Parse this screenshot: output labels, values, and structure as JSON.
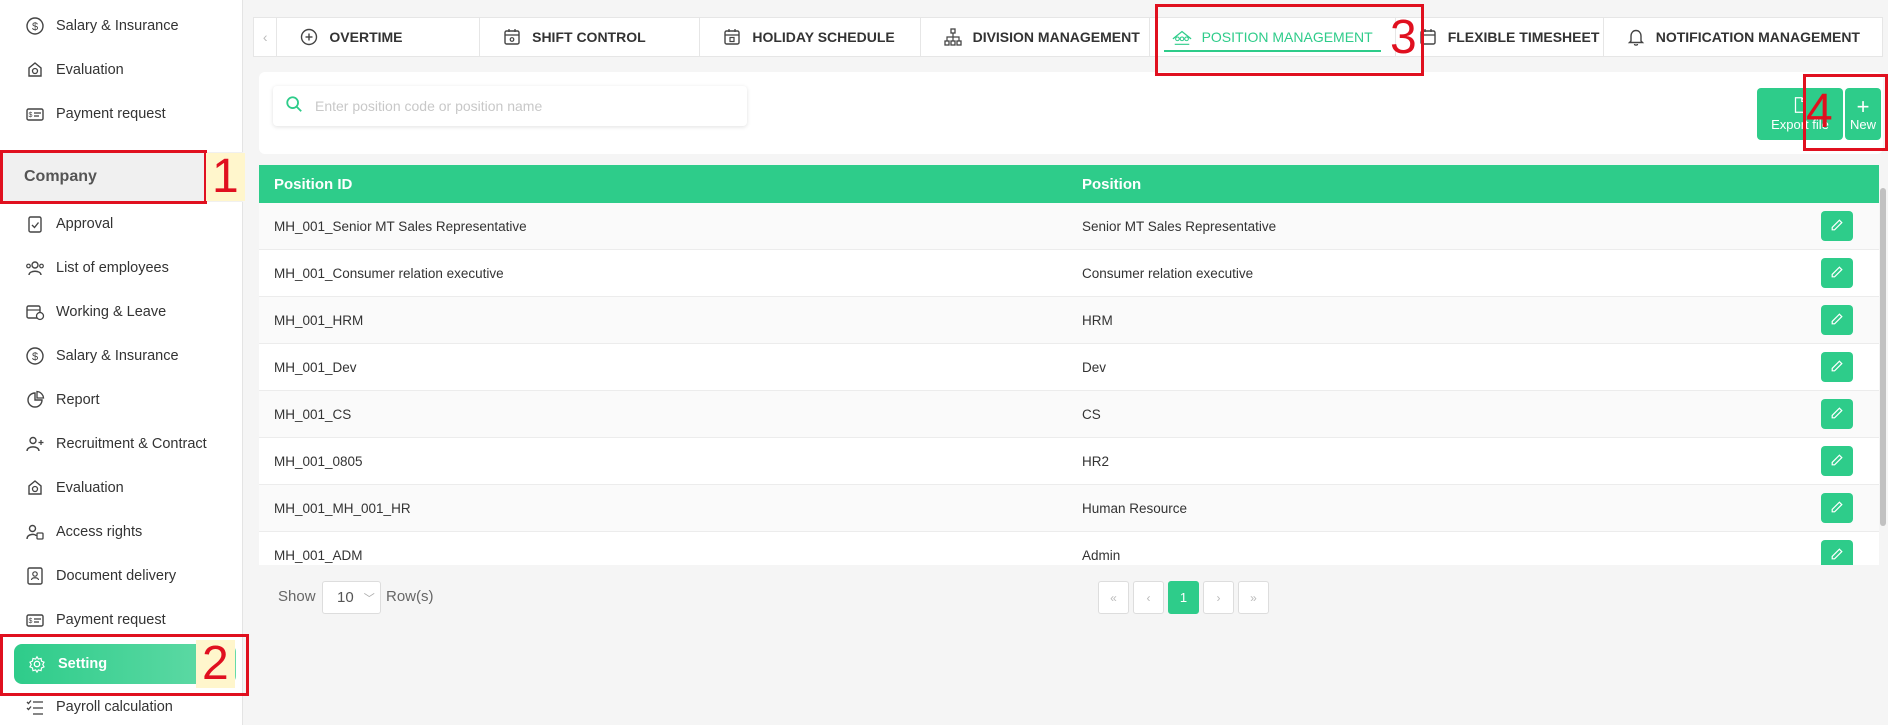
{
  "sidebar": {
    "top_items": [
      {
        "label": "Salary & Insurance",
        "icon": "dollar-icon"
      },
      {
        "label": "Evaluation",
        "icon": "evaluation-icon"
      },
      {
        "label": "Payment request",
        "icon": "payment-icon"
      }
    ],
    "company_header": "Company",
    "company_items": [
      {
        "label": "Approval",
        "icon": "clipboard-check-icon"
      },
      {
        "label": "List of employees",
        "icon": "users-icon"
      },
      {
        "label": "Working & Leave",
        "icon": "calendar-clock-icon"
      },
      {
        "label": "Salary & Insurance",
        "icon": "dollar-icon"
      },
      {
        "label": "Report",
        "icon": "pie-chart-icon"
      },
      {
        "label": "Recruitment & Contract",
        "icon": "user-plus-icon"
      },
      {
        "label": "Evaluation",
        "icon": "evaluation-icon"
      },
      {
        "label": "Access rights",
        "icon": "user-lock-icon"
      },
      {
        "label": "Document delivery",
        "icon": "id-card-icon"
      },
      {
        "label": "Payment request",
        "icon": "payment-icon"
      }
    ],
    "setting_label": "Setting",
    "payroll_label": "Payroll calculation"
  },
  "annotations": [
    "1",
    "2",
    "3",
    "4"
  ],
  "tabs": [
    {
      "label": "OVERTIME",
      "icon": "clock-plus-icon"
    },
    {
      "label": "SHIFT CONTROL",
      "icon": "calendar-icon"
    },
    {
      "label": "HOLIDAY SCHEDULE",
      "icon": "calendar-star-icon"
    },
    {
      "label": "DIVISION MANAGEMENT",
      "icon": "hierarchy-icon"
    },
    {
      "label": "POSITION MANAGEMENT",
      "icon": "position-icon"
    },
    {
      "label": "FLEXIBLE TIMESHEET",
      "icon": "calendar-icon"
    },
    {
      "label": "NOTIFICATION MANAGEMENT",
      "icon": "bell-icon"
    }
  ],
  "search": {
    "placeholder": "Enter position code or position name"
  },
  "toolbar": {
    "export_label": "Export file",
    "new_label": "New"
  },
  "table": {
    "headers": [
      "Position ID",
      "Position"
    ],
    "rows": [
      [
        "MH_001_Senior MT Sales Representative",
        "Senior MT Sales Representative"
      ],
      [
        "MH_001_Consumer relation executive",
        "Consumer relation executive"
      ],
      [
        "MH_001_HRM",
        "HRM"
      ],
      [
        "MH_001_Dev",
        "Dev"
      ],
      [
        "MH_001_CS",
        "CS"
      ],
      [
        "MH_001_0805",
        "HR2"
      ],
      [
        "MH_001_MH_001_HR",
        "Human Resource"
      ],
      [
        "MH_001_ADM",
        "Admin"
      ]
    ]
  },
  "footer": {
    "show_label": "Show",
    "rows_value": "10",
    "rows_label": "Row(s)",
    "current_page": "1"
  },
  "colors": {
    "accent": "#2ecc8a",
    "annotation": "#e0101f"
  }
}
